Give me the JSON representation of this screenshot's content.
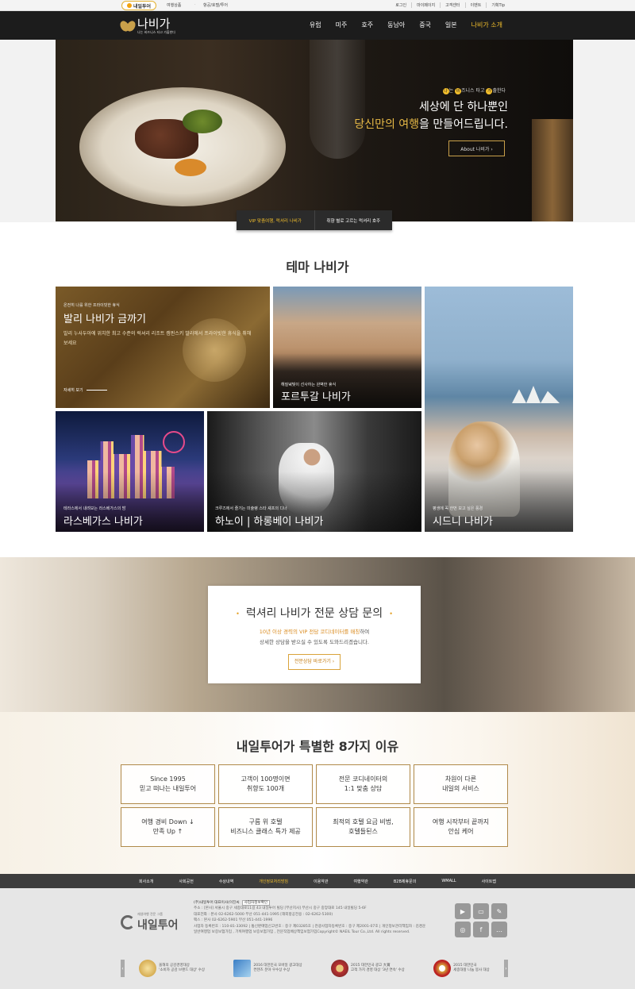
{
  "topbar": {
    "brand": "내일투어",
    "menu1": "여행상품",
    "menu2": "항공/호텔/투어",
    "links": [
      "로그인",
      "마이페이지",
      "고객센터",
      "이벤트",
      "기획Tip"
    ]
  },
  "gnb": {
    "logo_name": "나비가",
    "logo_tagline": "나는 비즈니스 타고 가출한다",
    "items": [
      "유럽",
      "미주",
      "호주",
      "동남아",
      "중국",
      "일본",
      "나비가 소개"
    ]
  },
  "hero": {
    "kicker_chars": [
      "나",
      "비",
      "가"
    ],
    "kicker_parts": [
      "는 ",
      "즈니스 타고 ",
      "출한다"
    ],
    "line1": "세상에 단 하나뿐인",
    "line2_highlight": "당신만의 여행",
    "line2_rest": "을 만들어드립니다.",
    "about_button": "About 나비가 ›",
    "tabs": [
      "VIP 맞춤여행, 럭셔리 나비가",
      "취향 별로 고르는 럭셔리 호주"
    ]
  },
  "theme": {
    "title": "테마 나비가",
    "cards": [
      {
        "caption": "온전히 나를 위한 프라이빗한 휴식",
        "title": "발리 나비가 금까기",
        "desc": "발리 누사두아에 위치한 최고 수준의 럭셔리 리조트 캠핀스키 발리에서 프라이빗한 휴식을 취해보세요",
        "more": "자세히 보기"
      },
      {
        "caption": "해질녘빛이 선사하는 완벽한 휴식",
        "title": "포르투갈 나비가"
      },
      {
        "caption": "평생에 꼭 한번 보고 싶은 풍경",
        "title": "시드니 나비가"
      },
      {
        "caption": "테라스에서 내려보는 라스베가스의 밤",
        "title": "라스베가스 나비가"
      },
      {
        "caption": "크루즈에서 즐기는 미슐랭 스타 셰프의 디너",
        "title": "하노이 | 하롱베이 나비가"
      }
    ]
  },
  "consult": {
    "title": "럭셔리 나비가 전문 상담 문의",
    "line1_highlight": "10년 이상 경력의 VIP 전담 코디네이터를 매칭",
    "line1_rest": "하여",
    "line2": "상세한 상담을 받으실 수 있도록 도와드리겠습니다.",
    "button": "전문상담 바로가기 ›"
  },
  "reasons": {
    "title": "내일투어가 특별한 8가지 이유",
    "items": [
      "Since 1995\n믿고 떠나는 내일투어",
      "고객이 100명이면\n취향도 100개",
      "전문 코디네이터의\n1:1 맞춤 상담",
      "차원이 다른\n내일의 서비스",
      "여행 경비 Down ↓\n만족 Up ↑",
      "구름 위 호텔\n비즈니스 클래스 특가 제공",
      "최적의 호텔 요금 비법,\n호텔들된스",
      "여행 시작부터 끝까지\n안심 케어"
    ]
  },
  "footer_nav": [
    "회사소개",
    "사회공헌",
    "수상내역",
    "개인정보처리방침",
    "이용약관",
    "여행약관",
    "B2B제휴문의",
    "WMALL",
    "사이트맵"
  ],
  "footer": {
    "logo_small": "재생여행 전문 그룹",
    "logo_name": "내일투어",
    "company": "(주)내일투어 대표이사(이진씨",
    "bizinfo_btn": "사업자정보확인",
    "address": "주소 : [본사] 서울시 중구 세종대로11길 43 내일투어 빌딩 [부산지사] 부산시 중구 중앙대로 145 내일빌딩 5-6F",
    "phone": "대표전화 : 본사 02-6262-5000 부산 051-441-1995 [해외항공전용 : 02-6262-5300)",
    "fax": "팩스 : 본사 02-6262-5901 부산 051-441-1996",
    "reg": "사업자 등록번호 : 110-81-33092 | 통신판매업신고번호 : 중구 제03285호 | 관광사업자등록번호 : 중구 제2001-07호 | 개인정보관리책임자 : 김경운",
    "insurance": "일반여행업 보증보험가입 , 기획여행업 보증보험가입 , 전문직업배상책임보험가입Copyright© NAEIL Tour Co.,Ltd. All rights reserved.",
    "social": [
      "youtube-icon",
      "chat-icon",
      "blog-icon",
      "instagram-icon",
      "facebook-icon",
      "talk-icon"
    ],
    "awards": [
      "올해의 공감경영대상\n'소비자 공감 브랜드 대상' 수상",
      "2016 대한민국 모바일 광고대상\n컨텐츠 분야 우수상 수상",
      "2015 대한민국 광고 大賞\n고객 가치 경영 대상 '3년 연속' 수상",
      "2015 대한민국\n세종대왕 나눔 봉사 대상"
    ]
  }
}
